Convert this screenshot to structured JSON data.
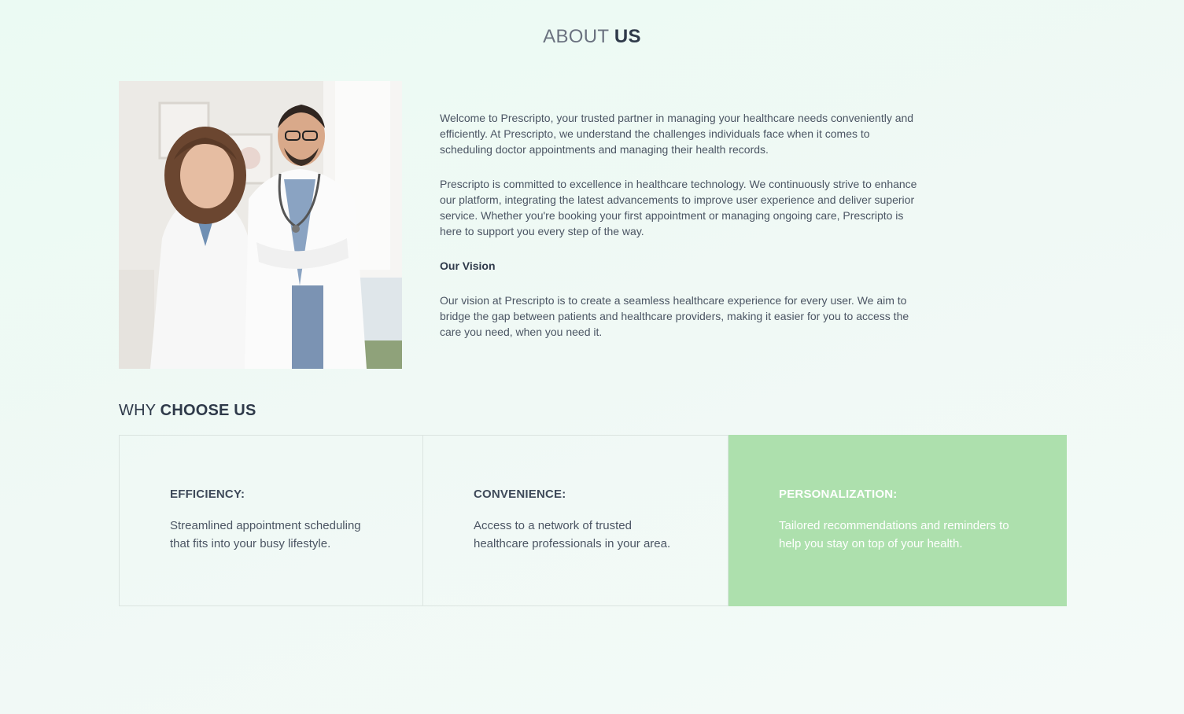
{
  "about": {
    "title_light": "ABOUT",
    "title_strong": "US",
    "paragraph_1": "Welcome to Prescripto, your trusted partner in managing your healthcare needs conveniently and efficiently. At Prescripto, we understand the challenges individuals face when it comes to scheduling doctor appointments and managing their health records.",
    "paragraph_2": "Prescripto is committed to excellence in healthcare technology. We continuously strive to enhance our platform, integrating the latest advancements to improve user experience and deliver superior service. Whether you're booking your first appointment or managing ongoing care, Prescripto is here to support you every step of the way.",
    "vision_title": "Our Vision",
    "vision_text": "Our vision at Prescripto is to create a seamless healthcare experience for every user. We aim to bridge the gap between patients and healthcare providers, making it easier for you to access the care you need, when you need it."
  },
  "why": {
    "title_light": "WHY",
    "title_strong": "CHOOSE US",
    "cards": [
      {
        "title": "EFFICIENCY:",
        "text": "Streamlined appointment scheduling that fits into your busy lifestyle."
      },
      {
        "title": "CONVENIENCE:",
        "text": "Access to a network of trusted healthcare professionals in your area."
      },
      {
        "title": "PERSONALIZATION:",
        "text": "Tailored recommendations and reminders to help you stay on top of your health."
      }
    ]
  },
  "colors": {
    "accent_card": "#ade0ad",
    "background": "#f0f9f5"
  }
}
